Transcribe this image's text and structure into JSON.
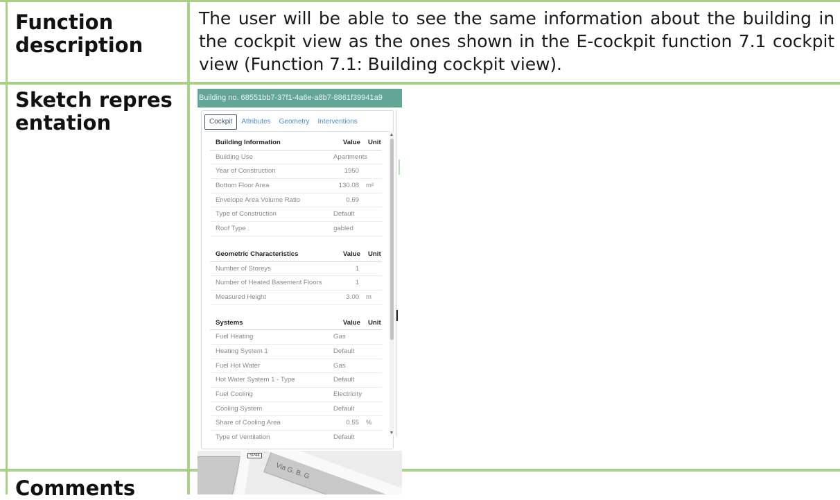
{
  "table": {
    "function_label": "Function description",
    "description": "The user will be able to see the same information about the building in the cockpit view as the ones shown in the E-cockpit function 7.1 cockpit view (Function 7.1: Building cockpit view).",
    "sketch_label": "Sketch representation",
    "comments_label": "Comments"
  },
  "screenshot": {
    "header": "Building no. 68551bb7-37f1-4a6e-a8b7-8861f39941a9",
    "tabs": [
      "Cockpit",
      "Attributes",
      "Geometry",
      "Interventions"
    ],
    "sections": [
      {
        "title": "Building Information",
        "value_header": "Value",
        "unit_header": "Unit",
        "rows": [
          {
            "label": "Building Use",
            "value": "Apartments",
            "unit": ""
          },
          {
            "label": "Year of Construction",
            "value": "1950",
            "unit": ""
          },
          {
            "label": "Bottom Floor Area",
            "value": "130.08",
            "unit": "m²"
          },
          {
            "label": "Envelope Area Volume Ratio",
            "value": "0.69",
            "unit": ""
          },
          {
            "label": "Type of Construction",
            "value": "Default",
            "unit": ""
          },
          {
            "label": "Roof Type",
            "value": "gabled",
            "unit": ""
          }
        ]
      },
      {
        "title": "Geometric Characteristics",
        "value_header": "Value",
        "unit_header": "Unit",
        "rows": [
          {
            "label": "Number of Storeys",
            "value": "1",
            "unit": ""
          },
          {
            "label": "Number of Heated Basement Floors",
            "value": "1",
            "unit": ""
          },
          {
            "label": "Measured Height",
            "value": "3.00",
            "unit": "m"
          }
        ]
      },
      {
        "title": "Systems",
        "value_header": "Value",
        "unit_header": "Unit",
        "rows": [
          {
            "label": "Fuel Heating",
            "value": "Gas",
            "unit": ""
          },
          {
            "label": "Heating System 1",
            "value": "Default",
            "unit": ""
          },
          {
            "label": "Fuel Hot Water",
            "value": "Gas",
            "unit": ""
          },
          {
            "label": "Hot Water System 1 - Type",
            "value": "Default",
            "unit": ""
          },
          {
            "label": "Fuel Cooling",
            "value": "Electricity",
            "unit": ""
          },
          {
            "label": "Cooling System",
            "value": "Default",
            "unit": ""
          },
          {
            "label": "Share of Cooling Area",
            "value": "0.55",
            "unit": "%"
          },
          {
            "label": "Type of Ventilation",
            "value": "Default",
            "unit": ""
          }
        ]
      }
    ],
    "map_road_label": "Via G. B. G",
    "map_badge": "SP44"
  },
  "colors": {
    "table_border": "#a9cf8a",
    "header_bg": "#63a597",
    "tab_link": "#4f8ed0"
  }
}
